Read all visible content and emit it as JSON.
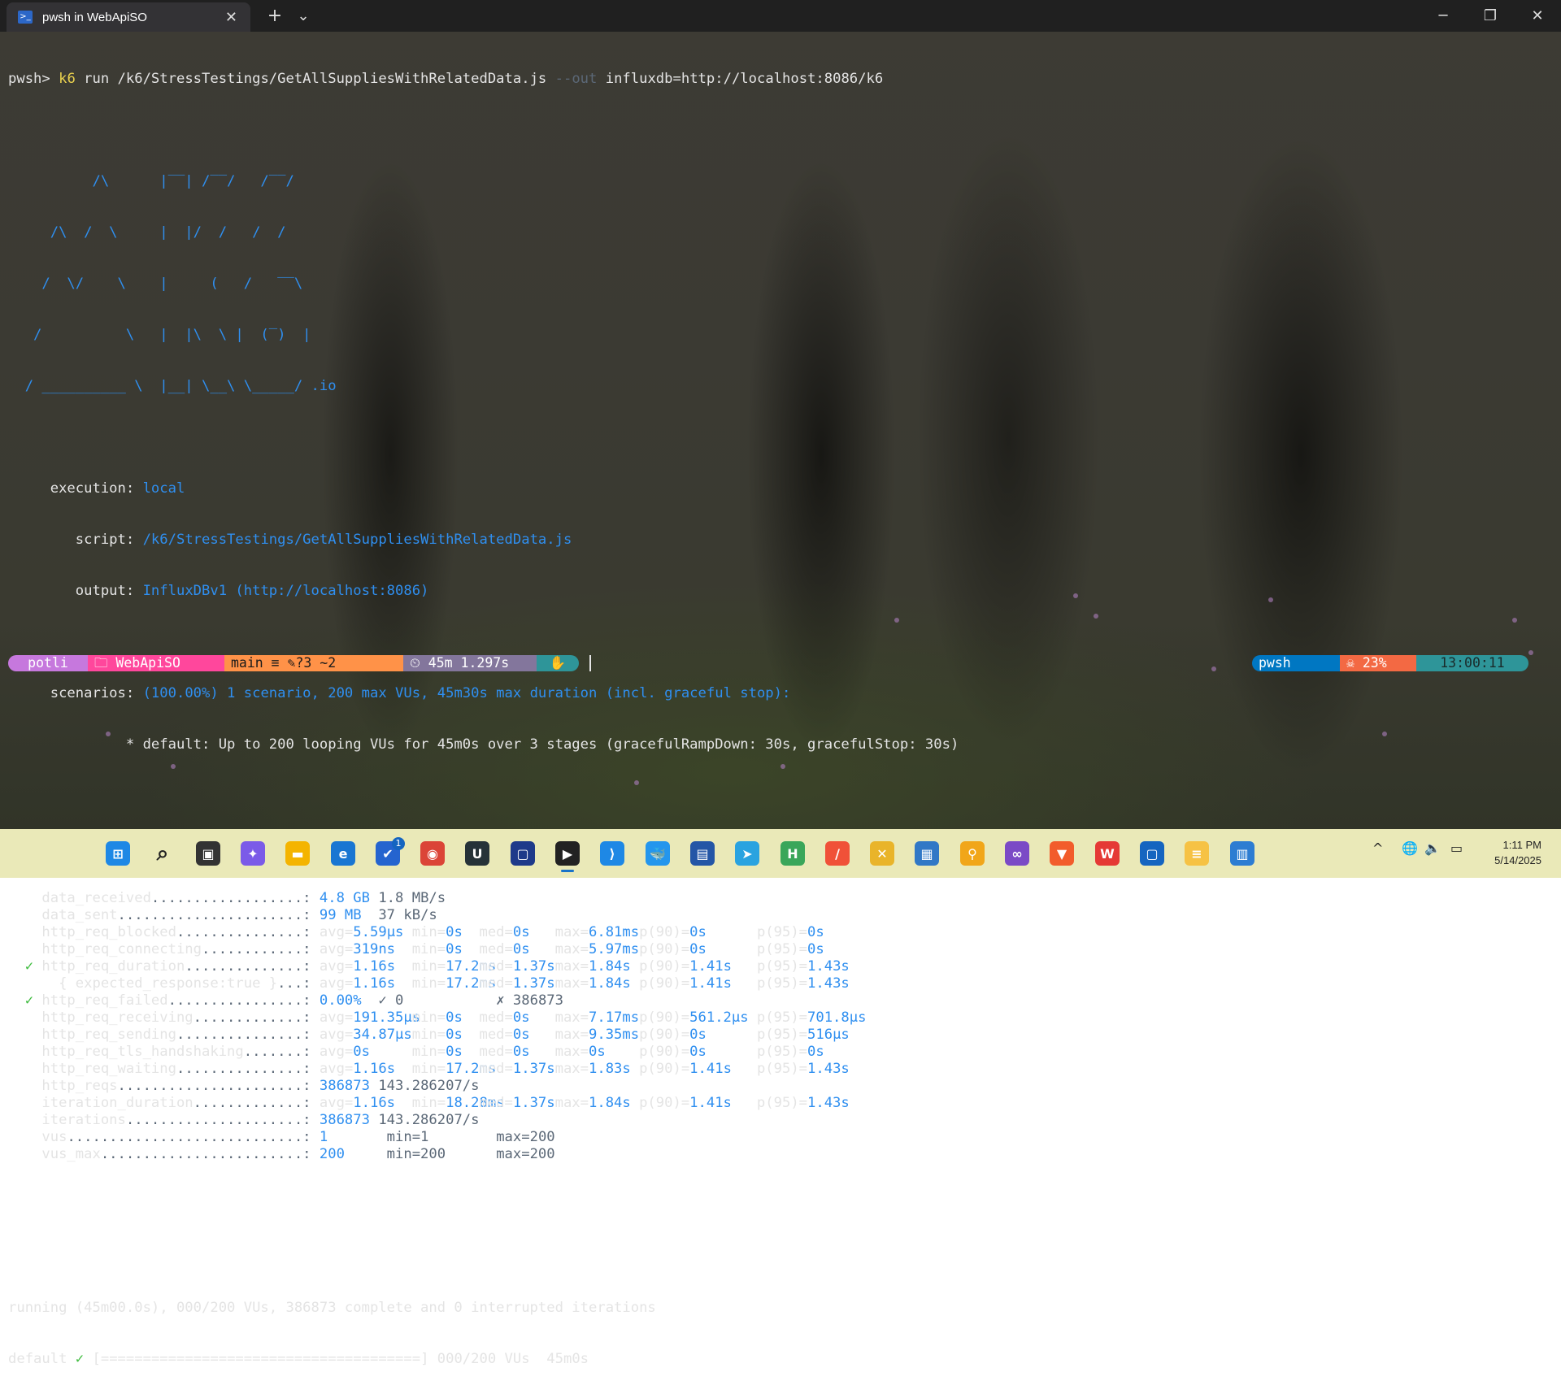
{
  "window": {
    "tab_title": "pwsh in WebApiSO",
    "new_tab": "+",
    "dropdown": "⌄",
    "minimize": "─",
    "maximize": "❐",
    "close": "✕",
    "tab_close": "✕"
  },
  "terminal": {
    "command_prompt": "pwsh> ",
    "command_bin": "k6",
    "command_rest": " run /k6/StressTestings/GetAllSuppliesWithRelatedData.js ",
    "command_flag": "--out",
    "command_arg": " influxdb=http://localhost:8086/k6",
    "logo_lines": [
      "          /\\      |‾‾| /‾‾/   /‾‾/",
      "     /\\  /  \\     |  |/  /   /  /",
      "    /  \\/    \\    |     (   /   ‾‾\\",
      "   /          \\   |  |\\  \\ |  (‾)  |",
      "  / __________ \\  |__| \\__\\ \\_____/ .io"
    ],
    "execution_label": "     execution: ",
    "execution_value": "local",
    "script_label": "        script: ",
    "script_value": "/k6/StressTestings/GetAllSuppliesWithRelatedData.js",
    "output_label": "        output: ",
    "output_value": "InfluxDBv1 (http://localhost:8086)",
    "scenarios_label": "     scenarios: ",
    "scenarios_value": "(100.00%) 1 scenario, 200 max VUs, 45m30s max duration (incl. graceful stop):",
    "scenario_default": "              * default: Up to 200 looping VUs for 45m0s over 3 stages (gracefulRampDown: 30s, gracefulStop: 30s)",
    "metrics": [
      {
        "check": "",
        "name": "data_received",
        "dots": "..................: ",
        "cols": [
          [
            "4.8 GB",
            "blue"
          ],
          [
            " 1.8 MB/s",
            "dim"
          ]
        ]
      },
      {
        "check": "",
        "name": "data_sent",
        "dots": "......................: ",
        "cols": [
          [
            "99 MB",
            "blue"
          ],
          [
            "  37 kB/s",
            "dim"
          ]
        ]
      },
      {
        "check": "",
        "name": "http_req_blocked",
        "dots": "...............: ",
        "stats": [
          "avg=5.59µs",
          "min=0s",
          "med=0s",
          "max=6.81ms",
          "p(90)=0s",
          "p(95)=0s"
        ]
      },
      {
        "check": "",
        "name": "http_req_connecting",
        "dots": "............: ",
        "stats": [
          "avg=319ns",
          "min=0s",
          "med=0s",
          "max=5.97ms",
          "p(90)=0s",
          "p(95)=0s"
        ]
      },
      {
        "check": "✓",
        "name": "http_req_duration",
        "dots": "..............: ",
        "stats": [
          "avg=1.16s",
          "min=17.2ms",
          "med=1.37s",
          "max=1.84s",
          "p(90)=1.41s",
          "p(95)=1.43s"
        ]
      },
      {
        "check": "",
        "name": "  { expected_response:true }",
        "dots": "...: ",
        "stats": [
          "avg=1.16s",
          "min=17.2ms",
          "med=1.37s",
          "max=1.84s",
          "p(90)=1.41s",
          "p(95)=1.43s"
        ]
      },
      {
        "check": "✓",
        "name": "http_req_failed",
        "dots": "................: ",
        "cols": [
          [
            "0.00%",
            "blue"
          ],
          [
            "  ✓ 0",
            "dim"
          ],
          [
            "           ✗ 386873",
            "dim"
          ]
        ]
      },
      {
        "check": "",
        "name": "http_req_receiving",
        "dots": ".............: ",
        "stats": [
          "avg=191.35µs",
          "min=0s",
          "med=0s",
          "max=7.17ms",
          "p(90)=561.2µs",
          "p(95)=701.8µs"
        ]
      },
      {
        "check": "",
        "name": "http_req_sending",
        "dots": "...............: ",
        "stats": [
          "avg=34.87µs",
          "min=0s",
          "med=0s",
          "max=9.35ms",
          "p(90)=0s",
          "p(95)=516µs"
        ]
      },
      {
        "check": "",
        "name": "http_req_tls_handshaking",
        "dots": ".......: ",
        "stats": [
          "avg=0s",
          "min=0s",
          "med=0s",
          "max=0s",
          "p(90)=0s",
          "p(95)=0s"
        ]
      },
      {
        "check": "",
        "name": "http_req_waiting",
        "dots": "...............: ",
        "stats": [
          "avg=1.16s",
          "min=17.2ms",
          "med=1.37s",
          "max=1.83s",
          "p(90)=1.41s",
          "p(95)=1.43s"
        ]
      },
      {
        "check": "",
        "name": "http_reqs",
        "dots": "......................: ",
        "cols": [
          [
            "386873",
            "blue"
          ],
          [
            " 143.286207/s",
            "dim"
          ]
        ]
      },
      {
        "check": "",
        "name": "iteration_duration",
        "dots": ".............: ",
        "stats": [
          "avg=1.16s",
          "min=18.28ms",
          "med=1.37s",
          "max=1.84s",
          "p(90)=1.41s",
          "p(95)=1.43s"
        ]
      },
      {
        "check": "",
        "name": "iterations",
        "dots": ".....................: ",
        "cols": [
          [
            "386873",
            "blue"
          ],
          [
            " 143.286207/s",
            "dim"
          ]
        ]
      },
      {
        "check": "",
        "name": "vus",
        "dots": "............................: ",
        "cols": [
          [
            "1",
            "blue"
          ],
          [
            "       min=1",
            "dim"
          ],
          [
            "        max=200",
            "dim"
          ]
        ]
      },
      {
        "check": "",
        "name": "vus_max",
        "dots": "........................: ",
        "cols": [
          [
            "200",
            "blue"
          ],
          [
            "     min=200",
            "dim"
          ],
          [
            "      max=200",
            "dim"
          ]
        ]
      }
    ],
    "running_line": "running (45m00.0s), 000/200 VUs, 386873 complete and 0 interrupted iterations",
    "default_label": "default ",
    "default_check": "✓",
    "default_bar": " [======================================] 000/200 VUs  45m0s"
  },
  "prompt": {
    "user": "potli",
    "folder": "🗀 WebApiSO",
    "git": "main ≡ ✎?3 ~2",
    "time": "⏲ 45m 1.297s",
    "status_icon": "✋",
    "shell": "pwsh",
    "battery": "☠ 23%",
    "clock": "13:00:11"
  },
  "colors": {
    "user_bg": "#c678dd",
    "folder_bg": "#ff479c",
    "git_bg": "#fffb38",
    "git_modified_bg": "#ff9248",
    "time_bg": "#83769c",
    "status_bg": "#2e9599",
    "shell_bg": "#0077c2",
    "battery_bg": "#f36943",
    "clock_bg": "#2e9599"
  },
  "taskbar": {
    "icons": [
      "windows-start",
      "search",
      "task-view",
      "copilot",
      "file-explorer",
      "edge",
      "todo",
      "chrome",
      "upnote",
      "obsidian",
      "terminal",
      "vscode",
      "docker",
      "floppy",
      "telegram",
      "hyper",
      "swift",
      "git-extensions",
      "rdm",
      "magnifier",
      "visual-studio",
      "brave",
      "wps",
      "vysor",
      "notepad",
      "taskmgr"
    ],
    "todo_badge": "1",
    "tray_chevron": "^",
    "time": "1:11 PM",
    "date": "5/14/2025"
  }
}
